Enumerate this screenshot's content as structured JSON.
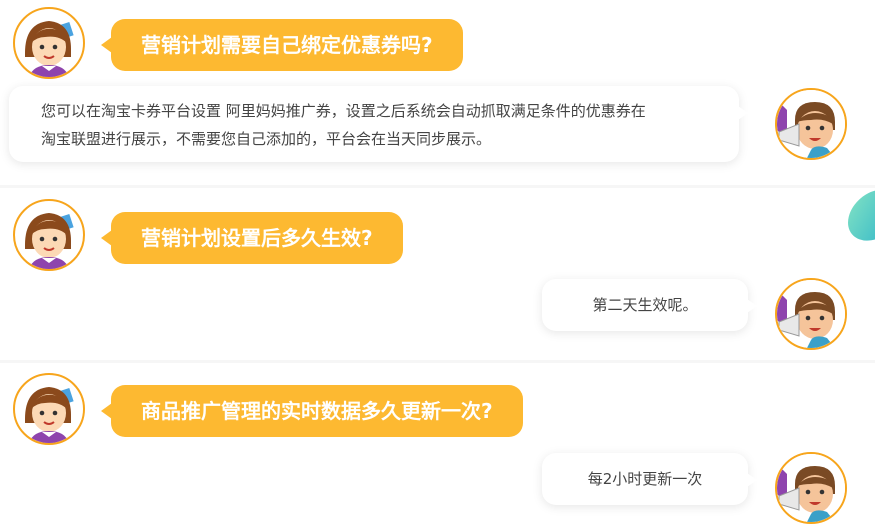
{
  "faq": [
    {
      "question": "营销计划需要自己绑定优惠券吗?",
      "answer_line1": "您可以在淘宝卡券平台设置 阿里妈妈推广券，设置之后系统会自动抓取满足条件的优惠券在",
      "answer_line2": "淘宝联盟进行展示，不需要您自己添加的，平台会在当天同步展示。"
    },
    {
      "question": "营销计划设置后多久生效?",
      "answer": "第二天生效呢。"
    },
    {
      "question": "商品推广管理的实时数据多久更新一次?",
      "answer": "每2小时更新一次"
    }
  ],
  "colors": {
    "accent": "#fdb931",
    "avatar_border": "#f7a51c",
    "answer_text": "#444444",
    "background": "#f6f6f6"
  },
  "icons": {
    "asker_avatar": "girl-avatar-icon",
    "answerer_avatar": "boy-megaphone-avatar-icon",
    "decoration": "teal-leaf-decoration"
  }
}
